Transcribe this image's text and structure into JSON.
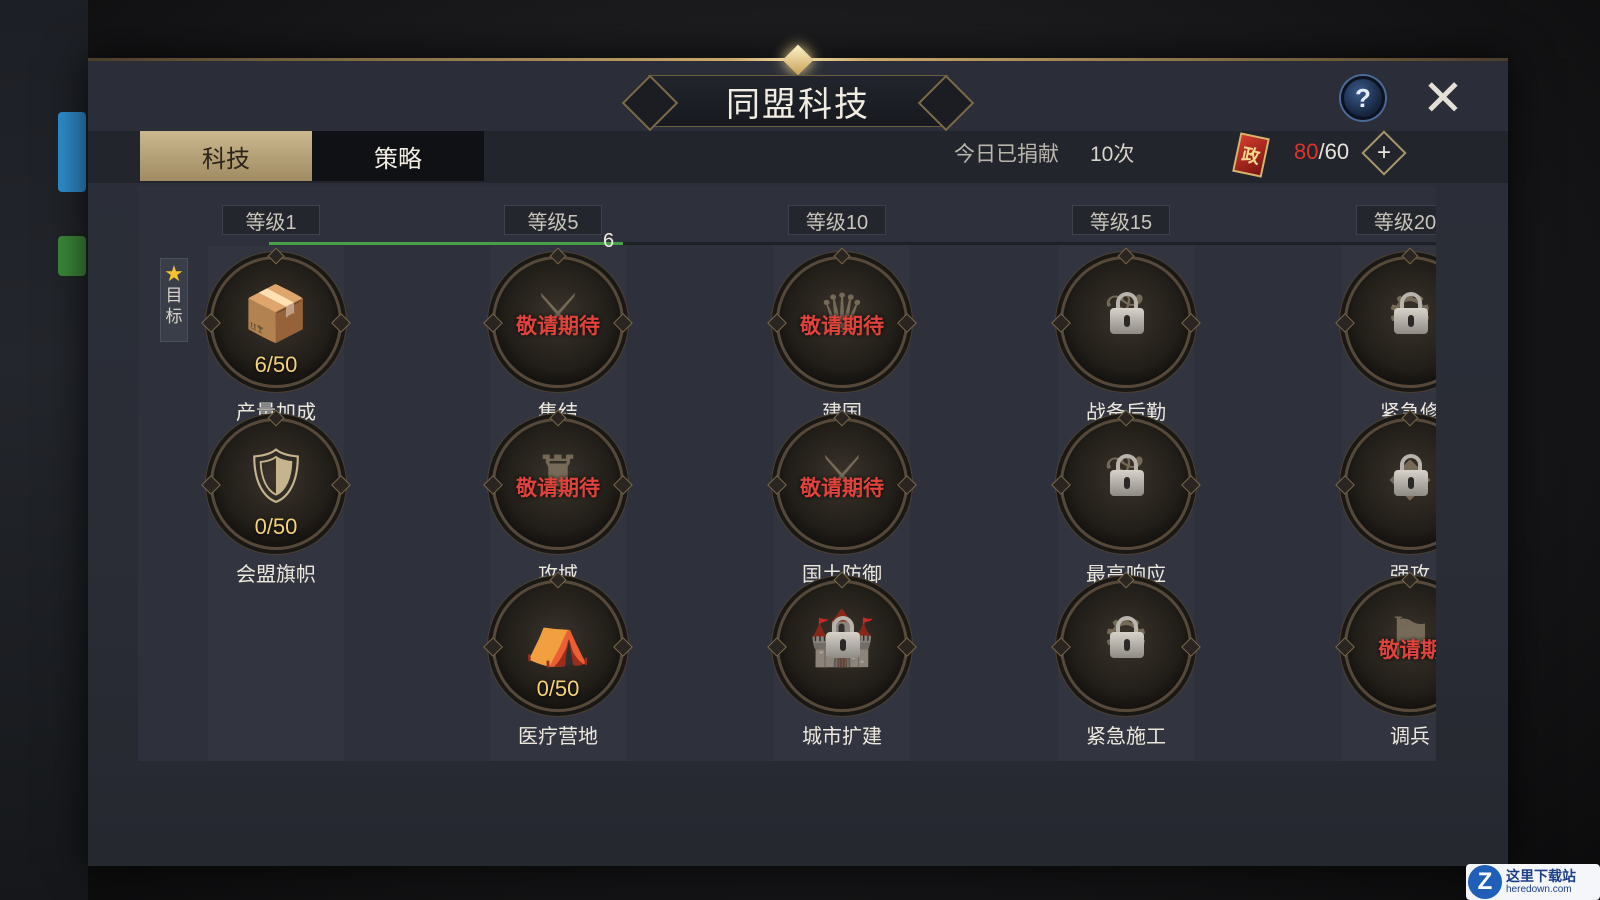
{
  "window": {
    "title": "同盟科技",
    "help_label": "?",
    "close_label": "✕"
  },
  "tabs": [
    {
      "label": "科技",
      "active": true
    },
    {
      "label": "策略",
      "active": false
    }
  ],
  "donation": {
    "label": "今日已捐献",
    "value": "10次"
  },
  "tokens": {
    "icon_char": "政",
    "current": "80",
    "separator": "/",
    "max": "60",
    "plus": "+"
  },
  "target_tab": {
    "star": "★",
    "line1": "目",
    "line2": "标"
  },
  "levels": [
    "等级1",
    "等级5",
    "等级10",
    "等级15",
    "等级20"
  ],
  "progress": {
    "value": "6",
    "fraction": 0.3
  },
  "nodes": {
    "c0r0": {
      "name": "产量加成",
      "progress": "6/50",
      "icon": "resource-crates-icon",
      "glyph": "📦"
    },
    "c0r1": {
      "name": "会盟旗帜",
      "progress": "0/50",
      "icon": "eagle-shield-icon",
      "glyph": "🛡"
    },
    "c1r0": {
      "name": "集结",
      "status": "敬请期待",
      "icon": "crossed-swords-icon",
      "glyph": "⚔"
    },
    "c1r1": {
      "name": "攻城",
      "status": "敬请期待",
      "icon": "castle-crest-icon",
      "glyph": "♜"
    },
    "c1r2": {
      "name": "医疗营地",
      "progress": "0/50",
      "icon": "medical-tent-icon",
      "glyph": "⛺"
    },
    "c2r0": {
      "name": "建国",
      "status": "敬请期待",
      "icon": "crown-emblem-icon",
      "glyph": "♛"
    },
    "c2r1": {
      "name": "国土防御",
      "status": "敬请期待",
      "icon": "crossed-shields-icon",
      "glyph": "⚔"
    },
    "c2r2": {
      "name": "城市扩建",
      "icon": "city-lock-icon",
      "glyph": "🏰"
    },
    "c3r0": {
      "name": "战备后勤",
      "icon": "laurel-lock-icon",
      "glyph": "❦"
    },
    "c3r1": {
      "name": "最高响应",
      "icon": "laurel-lock-icon",
      "glyph": "❦"
    },
    "c3r2": {
      "name": "紧急施工",
      "icon": "gear-lock-icon",
      "glyph": "⚙"
    },
    "c4r0": {
      "name": "紧急修",
      "icon": "gear-lock-icon",
      "glyph": "⚙"
    },
    "c4r1": {
      "name": "强攻",
      "icon": "diamond-lock-icon",
      "glyph": "◆"
    },
    "c4r2": {
      "name": "调兵",
      "status": "敬请期",
      "icon": "troop-emblem-icon",
      "glyph": "⚑"
    }
  },
  "watermark": {
    "logo": "Z",
    "cn": "这里下载站",
    "en": "heredown.com"
  },
  "colors": {
    "accent_gold": "#c9a86a",
    "progress_green": "#4aa04a",
    "coming_soon_red": "#e0433b",
    "token_red": "#e0342a"
  }
}
